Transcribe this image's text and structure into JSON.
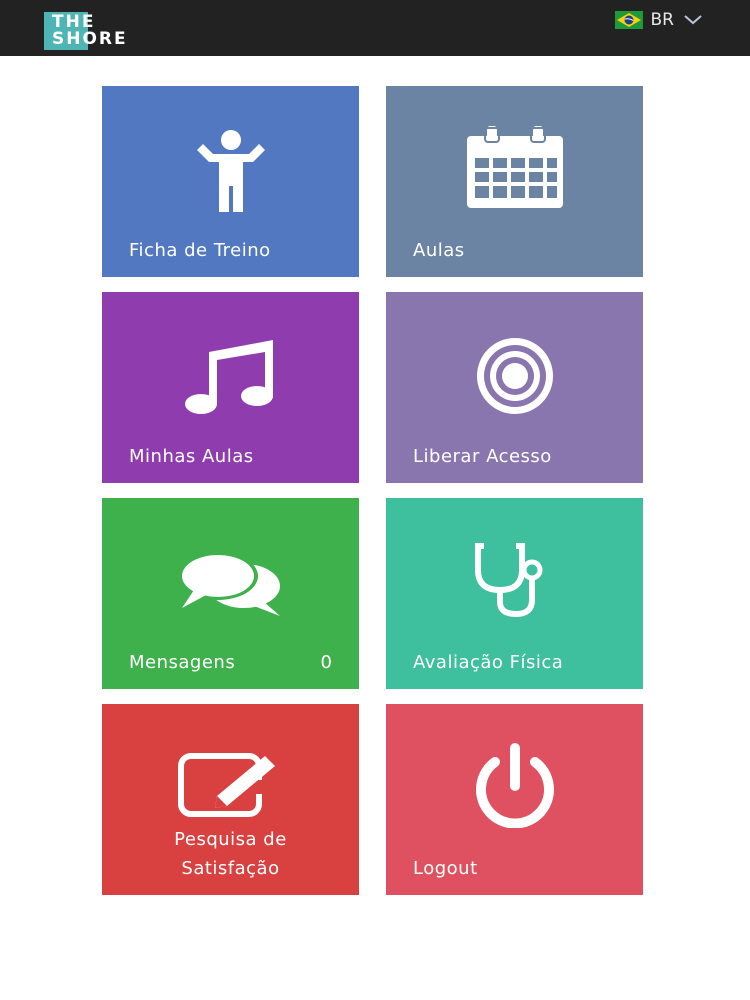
{
  "header": {
    "logo_line1": "THE",
    "logo_line2": "SHORE",
    "language_code": "BR",
    "flag_icon": "brazil-flag-icon",
    "dropdown_icon": "chevron-down-icon"
  },
  "tiles": [
    {
      "label": "Ficha de Treino",
      "icon": "person-icon",
      "color": "#5278c2"
    },
    {
      "label": "Aulas",
      "icon": "calendar-icon",
      "color": "#6c84a4"
    },
    {
      "label": "Minhas Aulas",
      "icon": "music-note-icon",
      "color": "#8e3cae"
    },
    {
      "label": "Liberar Acesso",
      "icon": "target-icon",
      "color": "#8a76ae"
    },
    {
      "label": "Mensagens",
      "badge": "0",
      "icon": "chat-bubbles-icon",
      "color": "#3fb14c"
    },
    {
      "label": "Avaliação Física",
      "icon": "stethoscope-icon",
      "color": "#3ebf9e"
    },
    {
      "label_line1": "Pesquisa de",
      "label_line2": "Satisfação",
      "icon": "edit-icon",
      "color": "#d94040"
    },
    {
      "label": "Logout",
      "icon": "power-icon",
      "color": "#df5060"
    }
  ]
}
